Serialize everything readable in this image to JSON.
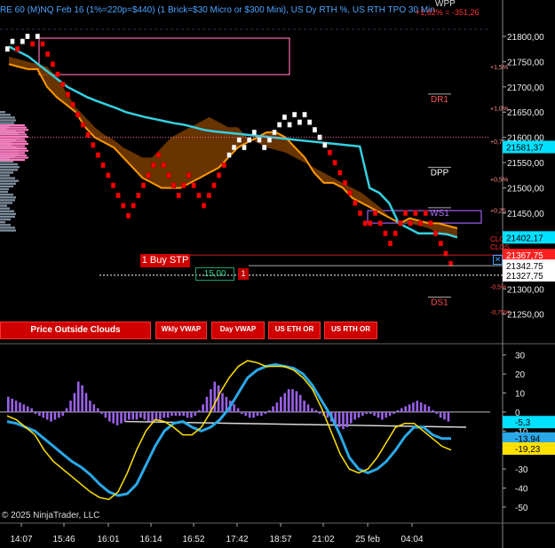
{
  "header": {
    "title": "RE 60 (M)NQ Feb 16  (1%=220p=$440) (1 Brick=$30 Micro or $300 Mini), US Dy RTH %, US RTH TPO 30 Min",
    "pct_change": "+1,62% = -351,26",
    "top_label": "WPP"
  },
  "colors": {
    "up": "#ffffff",
    "down": "#ff0000",
    "cloud": "#7a3d00",
    "vwap": "#35d0e0",
    "ma_orange": "#ff9900",
    "macd": "#2aa8e8",
    "signal": "#ffe000",
    "hist": "#9a62e8"
  },
  "chart_data": [
    {
      "type": "bar",
      "name": "price",
      "xlabel": "",
      "ylabel": "",
      "x_ticks": [
        "14:07",
        "15:46",
        "16:01",
        "16:14",
        "16:52",
        "17:42",
        "18:57",
        "21:02",
        "25 feb",
        "04:04"
      ],
      "y_ticks": [
        21800,
        21750,
        21700,
        21650,
        21600,
        21550,
        21500,
        21450,
        21400,
        21350,
        21300,
        21250
      ],
      "y_tick_labels": [
        "21800,00",
        "21750,00",
        "21700,00",
        "21650,00",
        "21600,00",
        "21550,00",
        "21500,00",
        "21450,00",
        "21400,00",
        "21350,00",
        "21300,00",
        "21250,00"
      ],
      "ylim": [
        21195,
        21872
      ],
      "pct_labels": [
        "+1,5%",
        "+1,0%",
        "+0,75",
        "+0,5%",
        "+0,25",
        "-0,5%",
        "-0,75%"
      ],
      "pct_values": [
        21740,
        21658,
        21592,
        21518,
        21456,
        21305,
        21255
      ],
      "levels": [
        {
          "name": "DR1",
          "value": 21670
        },
        {
          "name": "DPP",
          "value": 21525
        },
        {
          "name": "WS1",
          "value": 21445
        },
        {
          "name": "DS1",
          "value": 21268
        }
      ],
      "clo_labels": [
        "CLOS",
        "CLOS"
      ],
      "price_labels": [
        {
          "text": "21581,37",
          "value": 21581,
          "color": "#00e0ff",
          "fg": "#000"
        },
        {
          "text": "21402,17",
          "value": 21402,
          "color": "#00e0ff",
          "fg": "#000"
        },
        {
          "text": "21367,75",
          "value": 21367,
          "color": "#ff2020",
          "fg": "#fff"
        },
        {
          "text": "21342,75",
          "value": 21346,
          "color": "#ffffff",
          "fg": "#000"
        },
        {
          "text": "21327,75",
          "value": 21327,
          "color": "#ffffff",
          "fg": "#000"
        }
      ],
      "brick_size": 10,
      "bricks": [
        {
          "y": 21770,
          "d": 1
        },
        {
          "y": 21785,
          "d": 1
        },
        {
          "y": 21770,
          "d": -1
        },
        {
          "y": 21785,
          "d": 1
        },
        {
          "y": 21795,
          "d": 1
        },
        {
          "y": 21780,
          "d": -1
        },
        {
          "y": 21795,
          "d": 1
        },
        {
          "y": 21780,
          "d": -1
        },
        {
          "y": 21760,
          "d": -1
        },
        {
          "y": 21740,
          "d": -1
        },
        {
          "y": 21720,
          "d": -1
        },
        {
          "y": 21700,
          "d": -1
        },
        {
          "y": 21680,
          "d": -1
        },
        {
          "y": 21660,
          "d": -1
        },
        {
          "y": 21640,
          "d": -1
        },
        {
          "y": 21620,
          "d": -1
        },
        {
          "y": 21600,
          "d": -1
        },
        {
          "y": 21580,
          "d": -1
        },
        {
          "y": 21560,
          "d": -1
        },
        {
          "y": 21540,
          "d": -1
        },
        {
          "y": 21520,
          "d": -1
        },
        {
          "y": 21500,
          "d": -1
        },
        {
          "y": 21480,
          "d": -1
        },
        {
          "y": 21460,
          "d": -1
        },
        {
          "y": 21440,
          "d": -1
        },
        {
          "y": 21460,
          "d": -1
        },
        {
          "y": 21480,
          "d": -1
        },
        {
          "y": 21500,
          "d": -1
        },
        {
          "y": 21520,
          "d": -1
        },
        {
          "y": 21540,
          "d": -1
        },
        {
          "y": 21560,
          "d": -1
        },
        {
          "y": 21540,
          "d": -1
        },
        {
          "y": 21520,
          "d": -1
        },
        {
          "y": 21500,
          "d": -1
        },
        {
          "y": 21480,
          "d": -1
        },
        {
          "y": 21500,
          "d": -1
        },
        {
          "y": 21520,
          "d": -1
        },
        {
          "y": 21500,
          "d": -1
        },
        {
          "y": 21480,
          "d": -1
        },
        {
          "y": 21460,
          "d": -1
        },
        {
          "y": 21480,
          "d": -1
        },
        {
          "y": 21500,
          "d": -1
        },
        {
          "y": 21520,
          "d": -1
        },
        {
          "y": 21540,
          "d": -1
        },
        {
          "y": 21560,
          "d": 1
        },
        {
          "y": 21575,
          "d": 1
        },
        {
          "y": 21590,
          "d": 1
        },
        {
          "y": 21575,
          "d": 1
        },
        {
          "y": 21590,
          "d": 1
        },
        {
          "y": 21605,
          "d": 1
        },
        {
          "y": 21590,
          "d": 1
        },
        {
          "y": 21575,
          "d": 1
        },
        {
          "y": 21590,
          "d": 1
        },
        {
          "y": 21605,
          "d": 1
        },
        {
          "y": 21620,
          "d": 1
        },
        {
          "y": 21635,
          "d": 1
        },
        {
          "y": 21620,
          "d": 1
        },
        {
          "y": 21640,
          "d": 1
        },
        {
          "y": 21625,
          "d": 1
        },
        {
          "y": 21640,
          "d": 1
        },
        {
          "y": 21625,
          "d": 1
        },
        {
          "y": 21610,
          "d": 1
        },
        {
          "y": 21595,
          "d": 1
        },
        {
          "y": 21580,
          "d": 1
        },
        {
          "y": 21565,
          "d": -1
        },
        {
          "y": 21545,
          "d": -1
        },
        {
          "y": 21525,
          "d": -1
        },
        {
          "y": 21505,
          "d": -1
        },
        {
          "y": 21485,
          "d": -1
        },
        {
          "y": 21465,
          "d": -1
        },
        {
          "y": 21445,
          "d": -1
        },
        {
          "y": 21425,
          "d": -1
        },
        {
          "y": 21425,
          "d": -1
        },
        {
          "y": 21445,
          "d": -1
        },
        {
          "y": 21425,
          "d": -1
        },
        {
          "y": 21405,
          "d": -1
        },
        {
          "y": 21385,
          "d": -1
        },
        {
          "y": 21405,
          "d": -1
        },
        {
          "y": 21425,
          "d": -1
        },
        {
          "y": 21445,
          "d": -1
        },
        {
          "y": 21425,
          "d": -1
        },
        {
          "y": 21445,
          "d": -1
        },
        {
          "y": 21425,
          "d": -1
        },
        {
          "y": 21445,
          "d": -1
        },
        {
          "y": 21425,
          "d": -1
        },
        {
          "y": 21405,
          "d": -1
        },
        {
          "y": 21385,
          "d": -1
        },
        {
          "y": 21365,
          "d": -1
        },
        {
          "y": 21345,
          "d": -1
        }
      ],
      "vwap": [
        21780,
        21770,
        21760,
        21745,
        21730,
        21715,
        21700,
        21690,
        21680,
        21672,
        21665,
        21658,
        21650,
        21645,
        21640,
        21636,
        21632,
        21628,
        21625,
        21620,
        21615,
        21612,
        21610,
        21608,
        21606,
        21604,
        21602,
        21600,
        21598,
        21596,
        21594,
        21592,
        21590,
        21588,
        21586,
        21584,
        21582,
        21500,
        21490,
        21470,
        21430,
        21420,
        21410,
        21410,
        21410,
        21408,
        21402
      ],
      "ma_orange": [
        21745,
        21740,
        21735,
        21735,
        21700,
        21680,
        21665,
        21650,
        21620,
        21600,
        21590,
        21580,
        21560,
        21540,
        21520,
        21510,
        21500,
        21500,
        21500,
        21510,
        21520,
        21530,
        21540,
        21560,
        21580,
        21590,
        21600,
        21610,
        21610,
        21600,
        21580,
        21560,
        21530,
        21510,
        21510,
        21500,
        21480,
        21470,
        21460,
        21450,
        21440,
        21430,
        21440,
        21435,
        21430,
        21430,
        21425,
        21420
      ],
      "cloud_top": [
        21760,
        21755,
        21750,
        21745,
        21740,
        21720,
        21690,
        21660,
        21640,
        21620,
        21605,
        21595,
        21580,
        21570,
        21560,
        21560,
        21580,
        21600,
        21610,
        21620,
        21630,
        21640,
        21630,
        21620,
        21620,
        21600,
        21590,
        21580,
        21575,
        21570,
        21560,
        21550,
        21540,
        21530,
        21520,
        21510,
        21500,
        21490,
        21475,
        21460,
        21440,
        21430,
        21430,
        21425,
        21420,
        21410,
        21405,
        21400
      ],
      "cloud_bottom": [
        21745,
        21740,
        21735,
        21735,
        21700,
        21680,
        21665,
        21650,
        21620,
        21600,
        21590,
        21580,
        21560,
        21540,
        21520,
        21510,
        21500,
        21500,
        21500,
        21510,
        21520,
        21530,
        21540,
        21560,
        21580,
        21590,
        21600,
        21610,
        21610,
        21600,
        21580,
        21560,
        21530,
        21510,
        21510,
        21500,
        21480,
        21470,
        21460,
        21450,
        21440,
        21430,
        21440,
        21435,
        21430,
        21430,
        21425,
        21420
      ]
    },
    {
      "type": "line",
      "name": "macd",
      "xlabel": "",
      "ylabel": "",
      "y_ticks": [
        30,
        20,
        10,
        0,
        -10,
        -20,
        -30,
        -40,
        -50
      ],
      "ylim": [
        -58,
        35
      ],
      "value_labels": [
        {
          "text": "-5,3",
          "value": -5.3,
          "color": "#00e0ff",
          "fg": "#000"
        },
        {
          "text": "-13,94",
          "value": -13.94,
          "color": "#2aa8e8",
          "fg": "#000"
        },
        {
          "text": "-19,23",
          "value": -19.23,
          "color": "#ffe000",
          "fg": "#000"
        }
      ],
      "series": [
        {
          "values": [
            -5,
            -6,
            -8,
            -10,
            -14,
            -18,
            -22,
            -26,
            -29,
            -33,
            -38,
            -42,
            -44,
            -43,
            -38,
            -28,
            -18,
            -10,
            -6,
            -5,
            -8,
            -10,
            -8,
            -4,
            2,
            10,
            18,
            22,
            24,
            25,
            24,
            23,
            20,
            14,
            6,
            -2,
            -12,
            -24,
            -30,
            -32,
            -30,
            -26,
            -20,
            -13,
            -8,
            -8,
            -12,
            -14,
            -14
          ]
        },
        {
          "values": [
            -2,
            -4,
            -8,
            -12,
            -20,
            -26,
            -30,
            -34,
            -38,
            -42,
            -45,
            -46,
            -42,
            -32,
            -20,
            -10,
            -4,
            -5,
            -8,
            -12,
            -12,
            -8,
            0,
            10,
            18,
            24,
            27,
            26,
            24,
            24,
            24,
            22,
            18,
            12,
            2,
            -10,
            -22,
            -30,
            -32,
            -30,
            -24,
            -16,
            -8,
            -6,
            -6,
            -10,
            -14,
            -18,
            -20
          ]
        }
      ],
      "histogram": [
        8,
        7,
        6,
        5,
        4,
        3,
        2,
        -1,
        -2,
        -3,
        -4,
        -5,
        -4,
        -3,
        -2,
        2,
        6,
        10,
        16,
        14,
        10,
        6,
        4,
        2,
        -1,
        -3,
        -5,
        -6,
        -7,
        -6,
        -5,
        -4,
        -4,
        -4,
        -3,
        -4,
        -5,
        -5,
        -4,
        -4,
        -3,
        -3,
        -2,
        -2,
        -2,
        -2,
        -3,
        -3,
        -2,
        1,
        4,
        8,
        12,
        16,
        14,
        10,
        8,
        6,
        4,
        2,
        -1,
        -2,
        -3,
        -3,
        -2,
        -2,
        -1,
        1,
        3,
        5,
        8,
        10,
        12,
        12,
        11,
        9,
        6,
        4,
        2,
        1,
        -1,
        -2,
        -3,
        -5,
        -6,
        -8,
        -9,
        -8,
        -6,
        -4,
        -3,
        -2,
        -1,
        -1,
        -2,
        -3,
        -4,
        -3,
        -2,
        -1,
        1,
        2,
        3,
        4,
        5,
        6,
        5,
        4,
        3,
        1,
        -1,
        -3,
        -4,
        -5
      ]
    }
  ],
  "buttons": {
    "price_outside_clouds": "Price Outside Clouds",
    "wkly_vwap": "Wkly VWAP",
    "day_vwap": "Day VWAP",
    "us_eth_or": "US ETH OR",
    "us_rth_or": "US RTH OR"
  },
  "order": {
    "buy_stp": "1 Buy STP",
    "qty": "15,00",
    "count": "1",
    "close": "✕"
  },
  "copyright": "© 2025 NinjaTrader, LLC"
}
